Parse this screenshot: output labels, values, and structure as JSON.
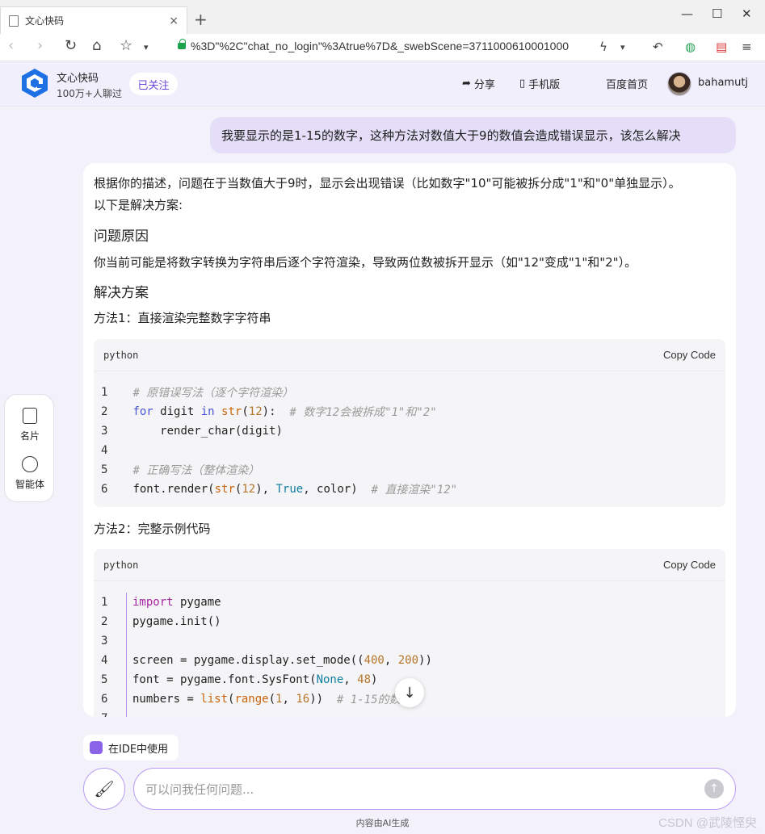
{
  "browser": {
    "tab_title": "文心快码",
    "tab_close": "×",
    "new_tab": "+",
    "url": "%3D\"%2C\"chat_no_login\"%3Atrue%7D&_swebScene=3711000610001000"
  },
  "header": {
    "brand_name": "文心快码",
    "brand_sub": "100万+人聊过",
    "follow_label": "已关注",
    "share_label": "分享",
    "mobile_label": "手机版",
    "baidu_label": "百度首页",
    "username": "bahamutj"
  },
  "chat": {
    "user_message": "我要显示的是1-15的数字，这种方法对数值大于9的数值会造成错误显示，该怎么解决",
    "intro_1": "根据你的描述，问题在于当数值大于9时，显示会出现错误（比如数字\"10\"可能被拆分成\"1\"和\"0\"单独显示）。",
    "intro_2": "以下是解决方案:",
    "cause_heading": "问题原因",
    "cause_text": "你当前可能是将数字转换为字符串后逐个字符渲染，导致两位数被拆开显示（如\"12\"变成\"1\"和\"2\"）。",
    "solution_heading": "解决方案",
    "method1": "方法1：直接渲染完整数字字符串",
    "method2": "方法2：完整示例代码",
    "code1": {
      "lang": "python",
      "copy": "Copy Code",
      "lines": [
        "1",
        "2",
        "3",
        "4",
        "5",
        "6"
      ],
      "comment_wrong": "# 原错误写法（逐个字符渲染）",
      "for_kw": "for",
      "digit_var": " digit ",
      "in_kw": "in",
      "str_fn": "str",
      "twelve": "12",
      "comment_split": "# 数字12会被拆成\"1\"和\"2\"",
      "render_call": "    render_char(digit)",
      "comment_right": "# 正确写法（整体渲染）",
      "font_render": "font.render(",
      "true_kw": "True",
      "color_arg": ", color)",
      "comment_direct": "# 直接渲染\"12\""
    },
    "code2": {
      "lang": "python",
      "copy": "Copy Code",
      "lines": [
        "1",
        "2",
        "3",
        "4",
        "5",
        "6",
        "7"
      ],
      "import_kw": "import",
      "pygame_mod": " pygame",
      "init_call": "pygame.init()",
      "screen_assign": "screen = pygame.display.set_mode((",
      "w400": "400",
      "h200": "200",
      "font_assign": "font = pygame.font.SysFont(",
      "none_kw": "None",
      "size48": "48",
      "numbers_assign": "numbers = ",
      "list_fn": "list",
      "range_fn": "range",
      "one": "1",
      "sixteen": "16",
      "comment_range": "# 1-15的数字"
    }
  },
  "side": {
    "card_label": "名片",
    "agent_label": "智能体"
  },
  "bottom": {
    "ide_label": "在IDE中使用",
    "placeholder": "可以问我任何问题...",
    "footer_note": "内容由AI生成",
    "watermark": "CSDN @武陵悭臾"
  }
}
